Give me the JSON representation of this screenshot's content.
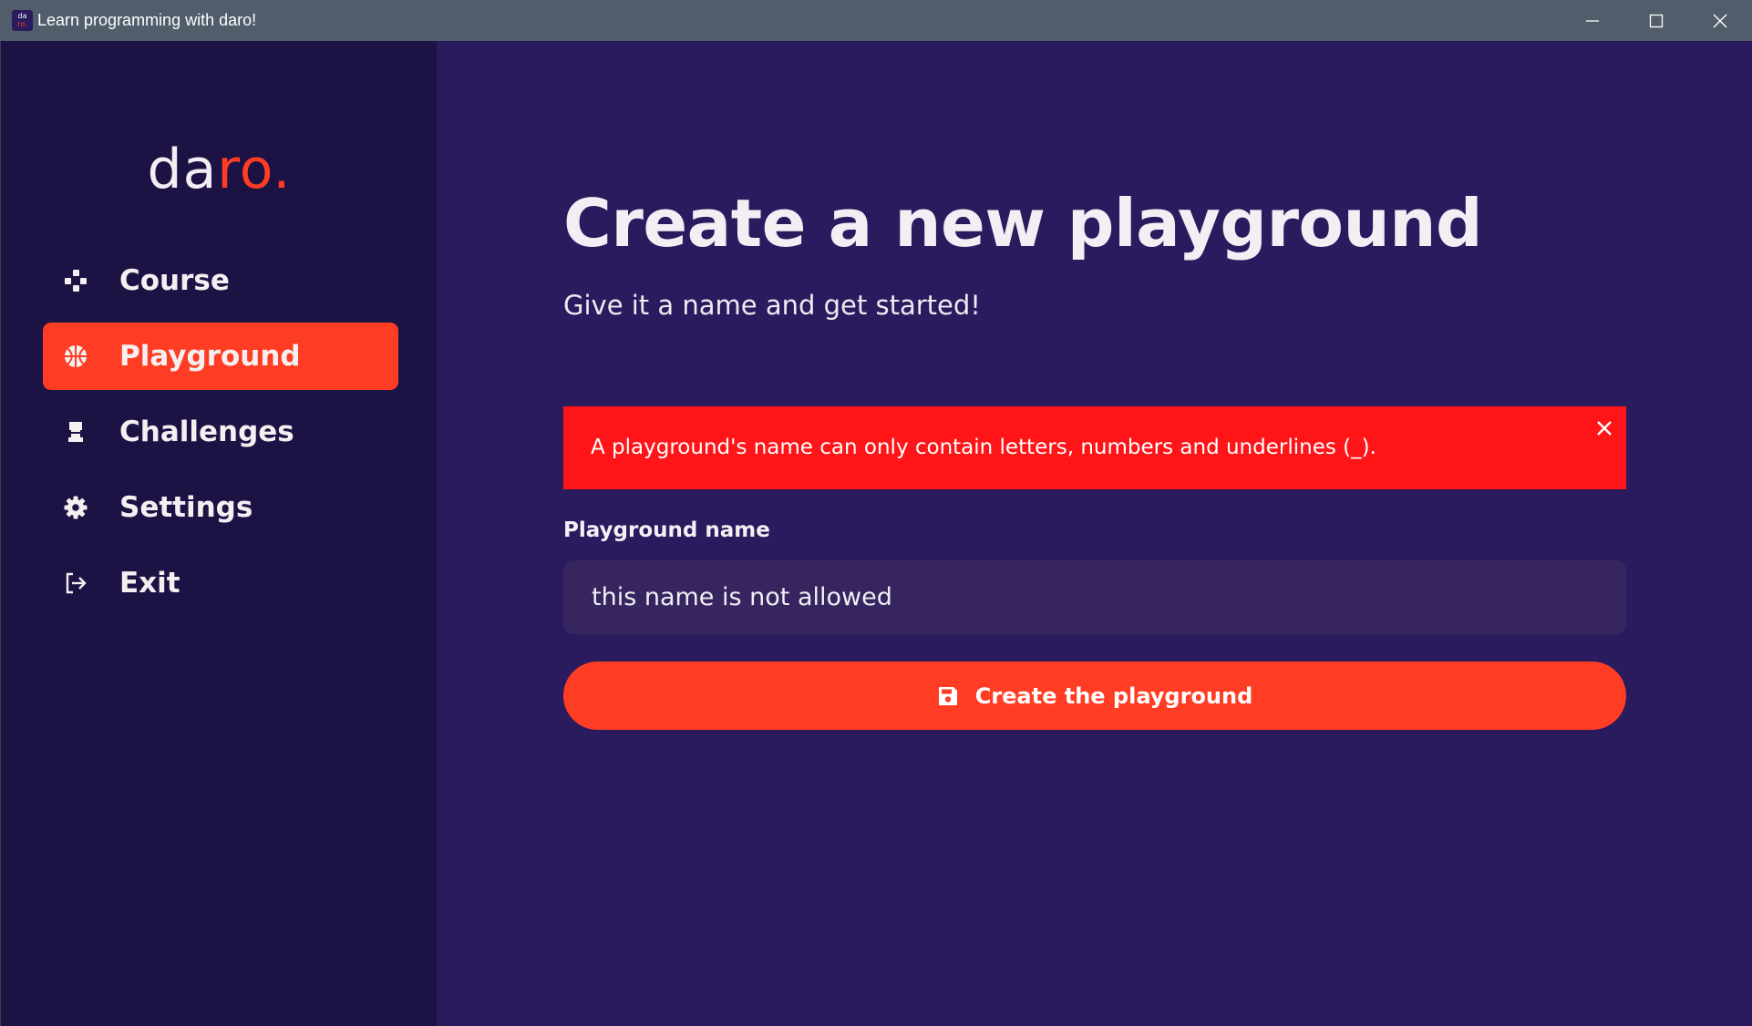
{
  "window": {
    "title": "Learn programming with daro!",
    "icon_text_top": "da",
    "icon_text_bottom": "ro.",
    "controls": [
      "minimize-icon",
      "maximize-icon",
      "close-icon"
    ]
  },
  "sidebar": {
    "logo_main": "da",
    "logo_accent": "ro.",
    "items": [
      {
        "label": "Course",
        "icon": "gamepad-icon",
        "active": false
      },
      {
        "label": "Playground",
        "icon": "basketball-icon",
        "active": true
      },
      {
        "label": "Challenges",
        "icon": "chess-rook-icon",
        "active": false
      },
      {
        "label": "Settings",
        "icon": "gear-icon",
        "active": false
      },
      {
        "label": "Exit",
        "icon": "sign-out-icon",
        "active": false
      }
    ]
  },
  "main": {
    "title": "Create a new playground",
    "subtitle": "Give it a name and get started!",
    "error": {
      "message": "A playground's name can only contain letters, numbers and underlines (_).",
      "close_icon": "close-icon"
    },
    "field_label": "Playground name",
    "input_value": "this name is not allowed",
    "button": {
      "label": "Create the playground",
      "icon": "save-icon"
    }
  },
  "colors": {
    "sidebar_bg": "#1c1244",
    "main_bg": "#2a1a5e",
    "accent": "#ff3d24",
    "error": "#ff1418",
    "input_bg": "#37255f",
    "titlebar": "#525d6b"
  }
}
